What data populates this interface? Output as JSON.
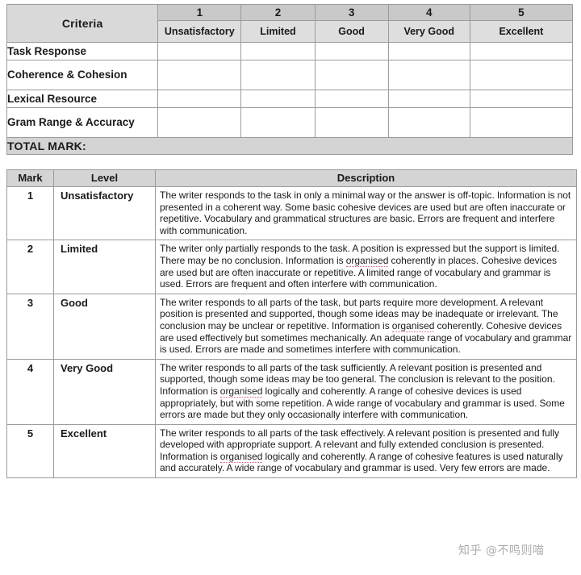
{
  "criteria_table": {
    "header": {
      "criteria_label": "Criteria",
      "bands": [
        {
          "number": "1",
          "name": "Unsatisfactory"
        },
        {
          "number": "2",
          "name": "Limited"
        },
        {
          "number": "3",
          "name": "Good"
        },
        {
          "number": "4",
          "name": "Very Good"
        },
        {
          "number": "5",
          "name": "Excellent"
        }
      ]
    },
    "rows": [
      {
        "label": "Task Response"
      },
      {
        "label": "Coherence & Cohesion"
      },
      {
        "label": "Lexical Resource"
      },
      {
        "label": "Gram Range & Accuracy"
      }
    ],
    "total_label": "TOTAL MARK:"
  },
  "descriptor_table": {
    "columns": {
      "mark": "Mark",
      "level": "Level",
      "description": "Description"
    },
    "rows": [
      {
        "mark": "1",
        "level": "Unsatisfactory",
        "description": "The writer responds to the task in only a minimal way or the answer is off-topic.  Information is not presented in a coherent way.  Some basic cohesive devices are used but are often inaccurate or repetitive. Vocabulary and grammatical structures are basic.  Errors are frequent and interfere with communication."
      },
      {
        "mark": "2",
        "level": "Limited",
        "description_pre": "The writer only partially responds to the task.  A position is expressed but the support is limited.  There may be no conclusion. Information is ",
        "description_flag": "organised",
        "description_post": " coherently in places. Cohesive devices are used but are often inaccurate or repetitive. A limited range of vocabulary and grammar is used. Errors are frequent and often interfere with communication."
      },
      {
        "mark": "3",
        "level": "Good",
        "description_pre": "The writer responds to all parts of the task, but parts require more development.  A relevant position is presented and supported, though some ideas may be inadequate or irrelevant.  The conclusion may be unclear or repetitive. Information is ",
        "description_flag": "organised",
        "description_post": " coherently. Cohesive devices are used effectively but sometimes mechanically.  An adequate range of vocabulary and grammar is used.  Errors are made and sometimes interfere with communication."
      },
      {
        "mark": "4",
        "level": "Very Good",
        "description_pre": "The writer responds to all parts of the task sufficiently.  A relevant position is presented and supported, though some ideas may be too general.  The conclusion is relevant to the position. Information is ",
        "description_flag": "organised",
        "description_post": " logically and coherently. A range of cohesive devices is used appropriately, but with some repetition. A wide range of vocabulary and grammar is used. Some errors are made but they only occasionally interfere with communication."
      },
      {
        "mark": "5",
        "level": "Excellent",
        "description_pre": "The writer responds to all parts of the task effectively.  A relevant position is presented and fully developed with appropriate support. A relevant and fully extended conclusion is presented. Information is ",
        "description_flag": "organised",
        "description_post": " logically and coherently. A range of cohesive features is used naturally and accurately. A wide range of vocabulary and grammar is used.  Very few errors are made."
      }
    ]
  },
  "watermark": {
    "text": "知乎 @不鸣则喵"
  },
  "colors": {
    "header_dark": "#c9c9c9",
    "header_mid": "#d4d4d4",
    "header_light": "#dedede",
    "border": "#9b9b9b",
    "spellcheck_underline": "#e05a7a"
  }
}
